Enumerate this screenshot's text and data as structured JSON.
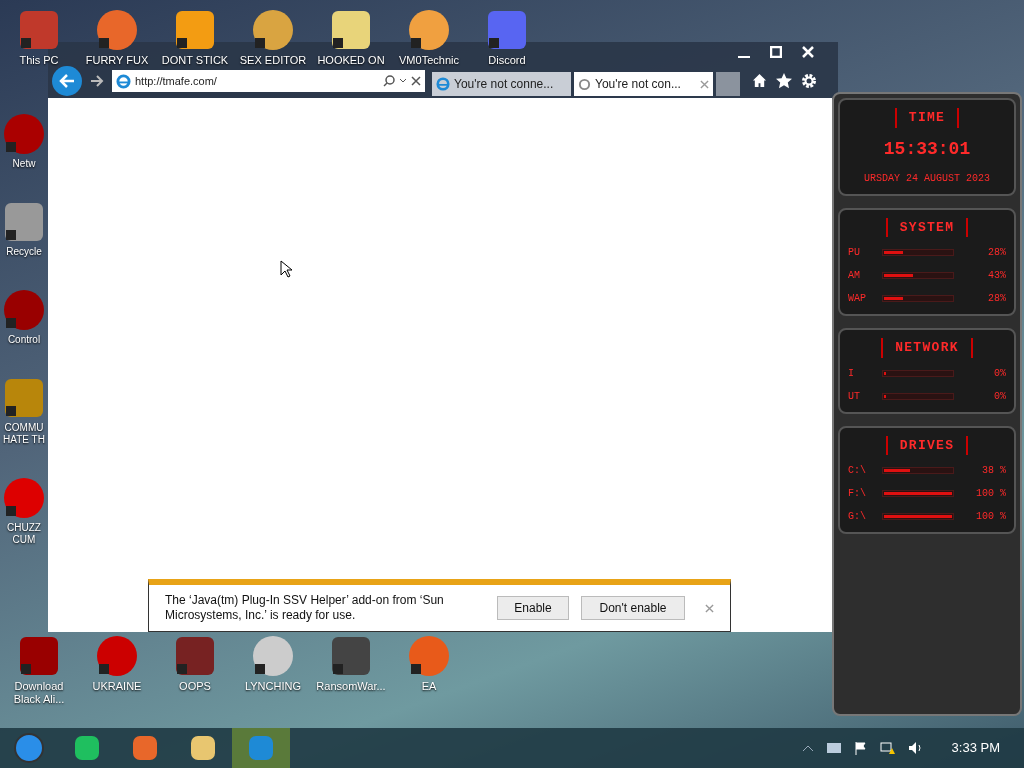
{
  "desktop": {
    "top_icons": [
      {
        "label": "This PC"
      },
      {
        "label": "FURRY FUX"
      },
      {
        "label": "DONT STICK"
      },
      {
        "label": "SEX EDITOR"
      },
      {
        "label": "HOOKED ON"
      },
      {
        "label": "VM0Technic"
      },
      {
        "label": "Discord"
      }
    ],
    "left_icons": [
      {
        "label": "Netw"
      },
      {
        "label": "Recycle"
      },
      {
        "label": "Control"
      },
      {
        "label": "COMMU HATE TH"
      },
      {
        "label": "CHUZZ CUM"
      }
    ],
    "bottom_icons": [
      {
        "label": "Download Black Ali..."
      },
      {
        "label": "UKRAINE"
      },
      {
        "label": "OOPS"
      },
      {
        "label": "LYNCHING"
      },
      {
        "label": "RansomWar..."
      },
      {
        "label": "EA"
      }
    ]
  },
  "browser": {
    "address": "http://tmafe.com/",
    "tabs": [
      {
        "title": "You're not conne...",
        "selected": false,
        "kind": "page"
      },
      {
        "title": "You're not con...",
        "selected": true,
        "kind": "loading"
      }
    ],
    "notification": {
      "message": "The ‘Java(tm) Plug-In SSV Helper’ add-on from ‘Sun Microsystems, Inc.’ is ready for use.",
      "buttons": [
        "Enable",
        "Don't enable"
      ]
    }
  },
  "widget": {
    "time": {
      "heading": "TIME",
      "clock": "15:33:01",
      "date": "URSDAY 24 AUGUST 2023"
    },
    "system": {
      "heading": "SYSTEM",
      "rows": [
        {
          "label": "PU",
          "value": "28%",
          "level": 0.28
        },
        {
          "label": "AM",
          "value": "43%",
          "level": 0.43
        },
        {
          "label": "WAP",
          "value": "28%",
          "level": 0.28
        }
      ]
    },
    "network": {
      "heading": "NETWORK",
      "rows": [
        {
          "label": "I",
          "value": "0%",
          "level": 0
        },
        {
          "label": "UT",
          "value": "0%",
          "level": 0
        }
      ]
    },
    "drives": {
      "heading": "DRIVES",
      "rows": [
        {
          "label": "C:\\",
          "value": "38 %",
          "level": 0.38
        },
        {
          "label": "F:\\",
          "value": "100 %",
          "level": 1
        },
        {
          "label": "G:\\",
          "value": "100 %",
          "level": 1
        }
      ]
    }
  },
  "taskbar": {
    "apps": [
      {
        "selected": false
      },
      {
        "selected": false
      },
      {
        "selected": false
      },
      {
        "selected": false
      },
      {
        "selected": true
      }
    ],
    "clock": "3:33 PM"
  }
}
